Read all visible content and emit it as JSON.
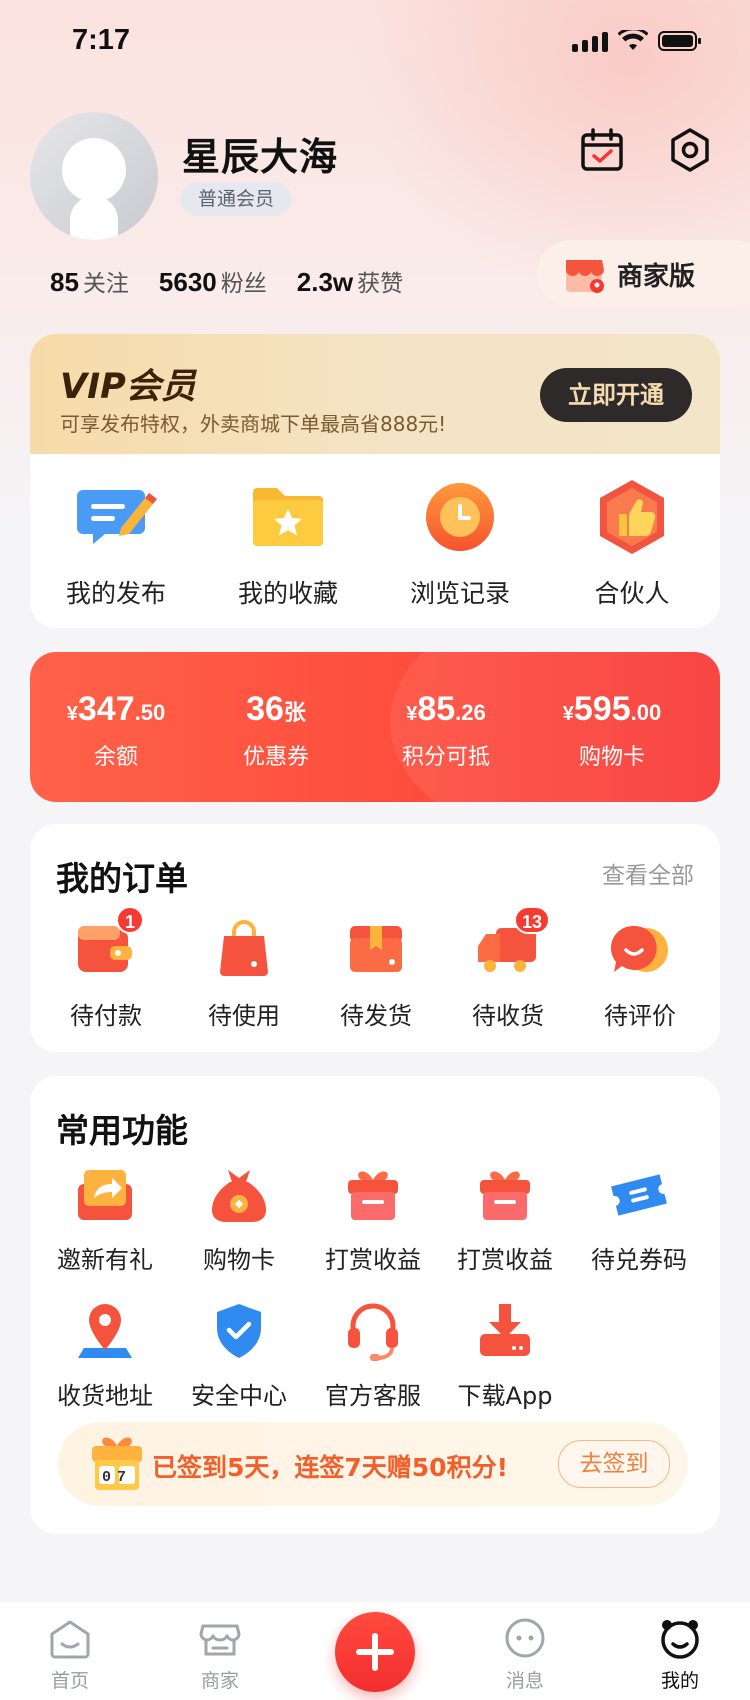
{
  "status_bar": {
    "time": "7:17"
  },
  "profile": {
    "name": "星辰大海",
    "level": "普通会员",
    "stats": [
      {
        "value": "85",
        "label": "关注"
      },
      {
        "value": "5630",
        "label": "粉丝"
      },
      {
        "value": "2.3w",
        "label": "获赞"
      }
    ],
    "merchant_label": "商家版",
    "icons": {
      "calendar": "calendar-check-icon",
      "settings": "settings-icon"
    }
  },
  "vip": {
    "title": "VIP会员",
    "subtitle": "可享发布特权，外卖商城下单最高省888元!",
    "button": "立即开通"
  },
  "quick_links": [
    {
      "label": "我的发布",
      "icon": "edit-message-icon"
    },
    {
      "label": "我的收藏",
      "icon": "star-folder-icon"
    },
    {
      "label": "浏览记录",
      "icon": "clock-icon"
    },
    {
      "label": "合伙人",
      "icon": "thumbs-up-icon"
    }
  ],
  "wallet": [
    {
      "currency": "¥",
      "int": "347",
      "dec": ".50",
      "label": "余额"
    },
    {
      "currency": "",
      "int": "36",
      "dec": "张",
      "label": "优惠券"
    },
    {
      "currency": "¥",
      "int": "85",
      "dec": ".26",
      "label": "积分可抵"
    },
    {
      "currency": "¥",
      "int": "595",
      "dec": ".00",
      "label": "购物卡"
    }
  ],
  "orders": {
    "title": "我的订单",
    "view_all": "查看全部",
    "items": [
      {
        "label": "待付款",
        "icon": "wallet-icon",
        "badge": "1"
      },
      {
        "label": "待使用",
        "icon": "shopping-bag-icon",
        "badge": ""
      },
      {
        "label": "待发货",
        "icon": "package-box-icon",
        "badge": ""
      },
      {
        "label": "待收货",
        "icon": "delivery-truck-icon",
        "badge": "13"
      },
      {
        "label": "待评价",
        "icon": "comment-icon",
        "badge": ""
      }
    ]
  },
  "tools": {
    "title": "常用功能",
    "items": [
      {
        "label": "邀新有礼",
        "icon": "share-gift-icon"
      },
      {
        "label": "购物卡",
        "icon": "money-bag-icon"
      },
      {
        "label": "打赏收益",
        "icon": "gift-box-icon"
      },
      {
        "label": "打赏收益",
        "icon": "gift-box-icon"
      },
      {
        "label": "待兑券码",
        "icon": "ticket-icon"
      },
      {
        "label": "收货地址",
        "icon": "location-pin-icon"
      },
      {
        "label": "安全中心",
        "icon": "shield-check-icon"
      },
      {
        "label": "官方客服",
        "icon": "headset-icon"
      },
      {
        "label": "下载App",
        "icon": "download-icon"
      }
    ],
    "checkin": {
      "days": "07",
      "text": "已签到5天，连签7天赠50积分!",
      "button": "去签到"
    }
  },
  "tab_bar": [
    {
      "label": "首页",
      "icon": "home-icon"
    },
    {
      "label": "商家",
      "icon": "store-icon"
    },
    {
      "label": "",
      "icon": "plus-icon"
    },
    {
      "label": "消息",
      "icon": "message-icon"
    },
    {
      "label": "我的",
      "icon": "profile-face-icon",
      "active": true
    }
  ],
  "colors": {
    "accent": "#F83634",
    "vip_gold": "#F6DBA9",
    "text": "#111111",
    "muted": "#999999"
  }
}
